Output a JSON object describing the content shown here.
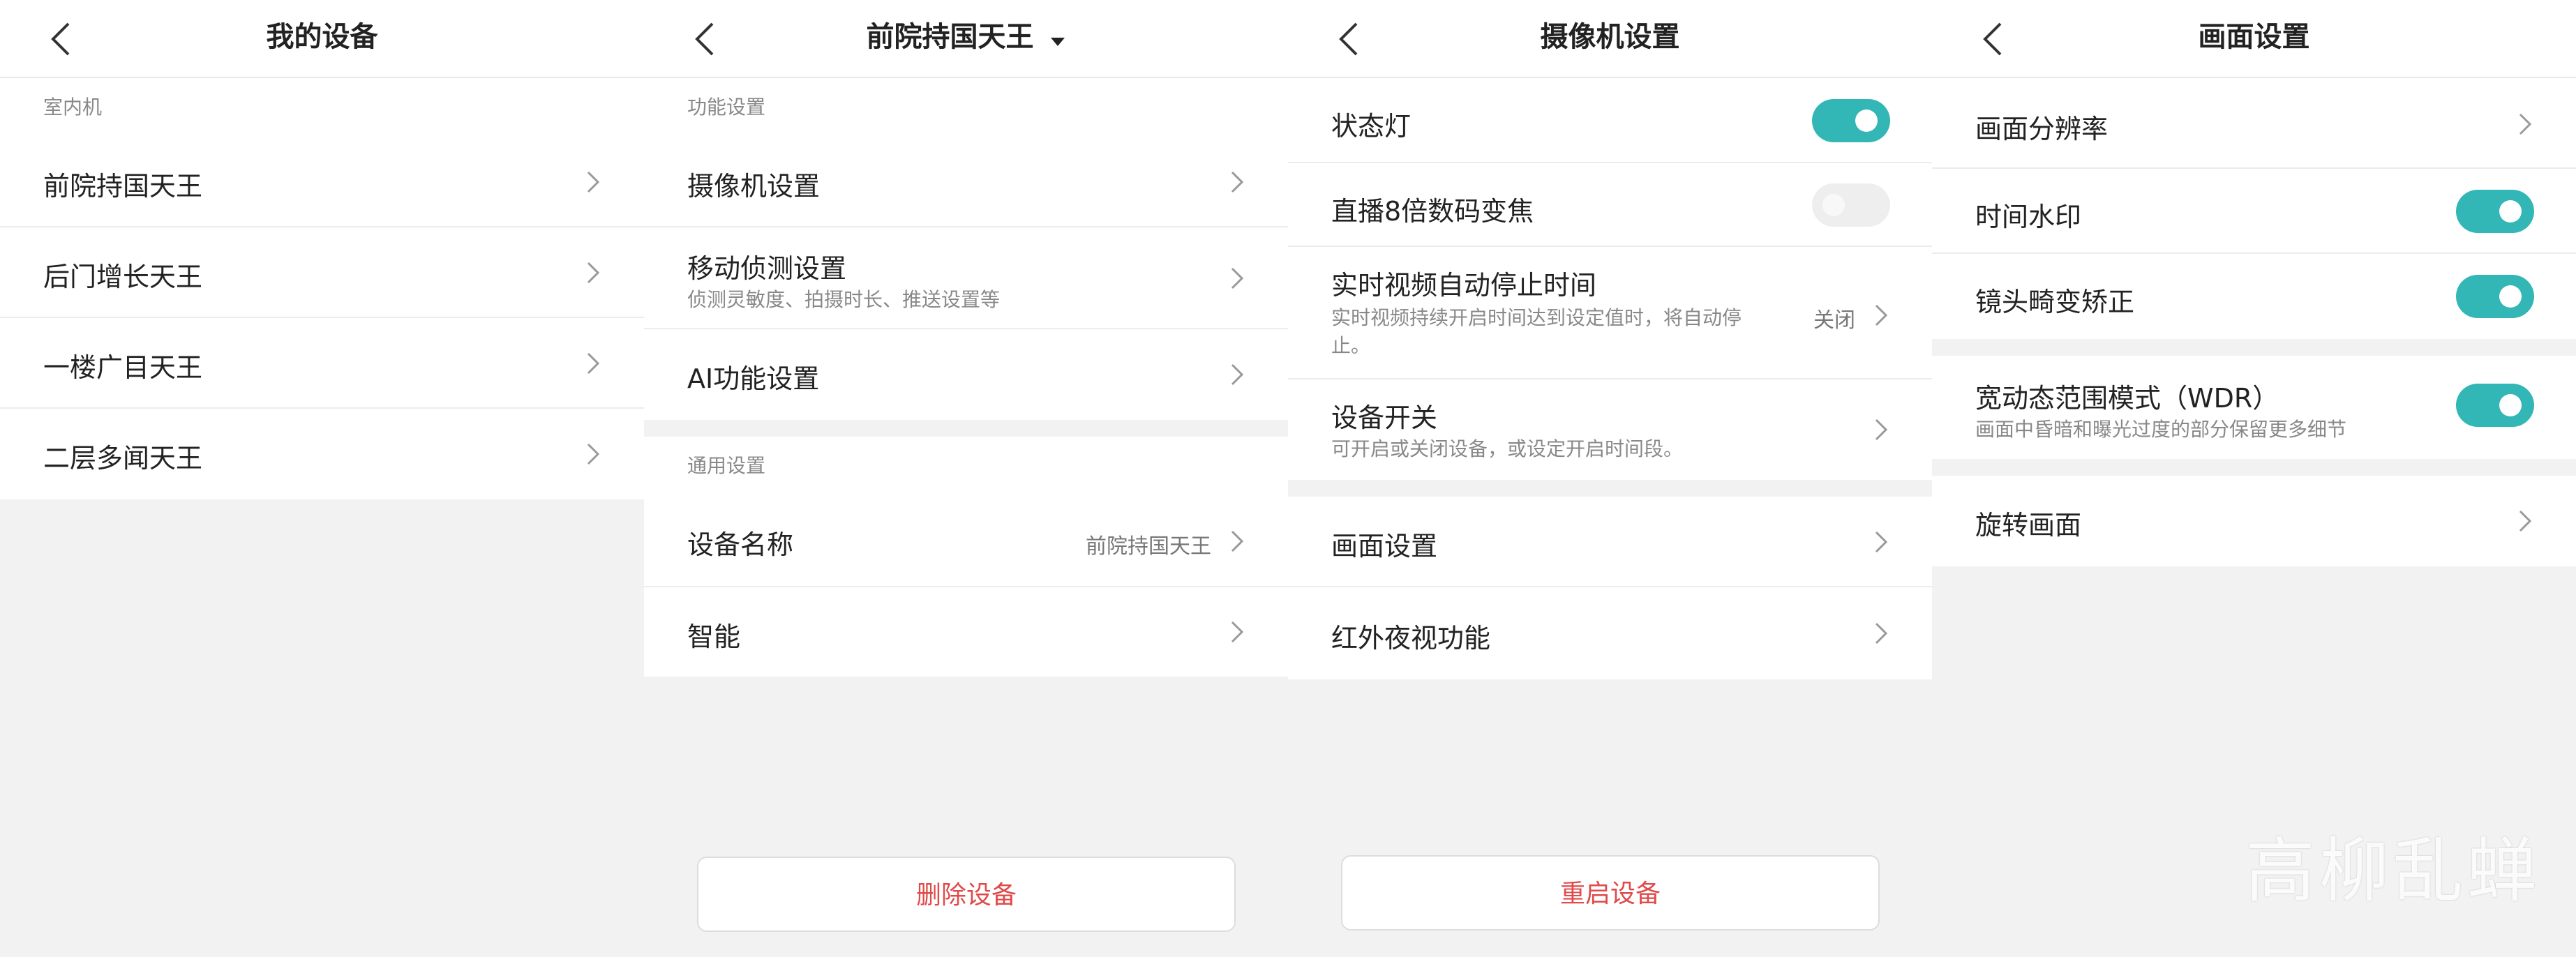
{
  "panel1": {
    "title": "我的设备",
    "section": "室内机",
    "items": [
      {
        "label": "前院持国天王"
      },
      {
        "label": "后门增长天王"
      },
      {
        "label": "一楼广目天王"
      },
      {
        "label": "二层多闻天王"
      }
    ]
  },
  "panel2": {
    "title": "前院持国天王",
    "section1": "功能设置",
    "camera": "摄像机设置",
    "motion": "移动侦测设置",
    "motion_sub": "侦测灵敏度、拍摄时长、推送设置等",
    "ai": "AI功能设置",
    "section2": "通用设置",
    "name_label": "设备名称",
    "name_value": "前院持国天王",
    "smart": "智能",
    "delete": "删除设备"
  },
  "panel3": {
    "title": "摄像机设置",
    "status_light": "状态灯",
    "zoom": "直播8倍数码变焦",
    "autostop": "实时视频自动停止时间",
    "autostop_sub1": "实时视频持续开启时间达到设定值时，将自动停",
    "autostop_sub2": "止。",
    "autostop_value": "关闭",
    "power": "设备开关",
    "power_sub": "可开启或关闭设备，或设定开启时间段。",
    "picture": "画面设置",
    "ir": "红外夜视功能",
    "restart": "重启设备",
    "status_light_on": true,
    "zoom_on": false
  },
  "panel4": {
    "title": "画面设置",
    "resolution": "画面分辨率",
    "timestamp": "时间水印",
    "distortion": "镜头畸变矫正",
    "wdr": "宽动态范围模式（WDR）",
    "wdr_sub": "画面中昏暗和曝光过度的部分保留更多细节",
    "rotate": "旋转画面",
    "timestamp_on": true,
    "distortion_on": true,
    "wdr_on": true
  },
  "watermark": "高柳乱蝉",
  "colors": {
    "accent": "#33b6b6",
    "danger": "#e04a4a"
  }
}
